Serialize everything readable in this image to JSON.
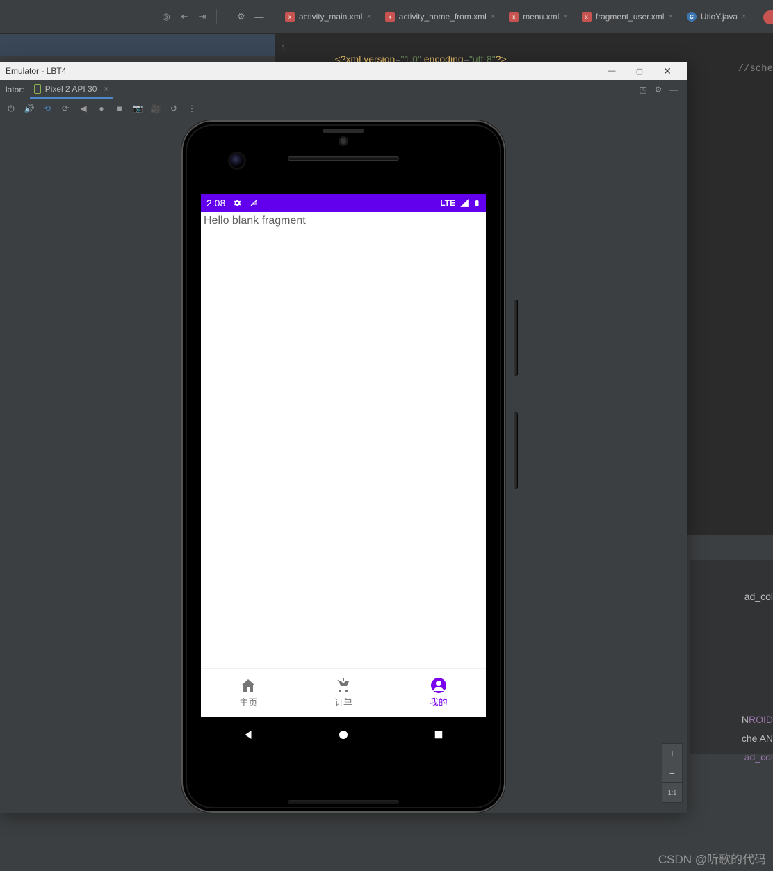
{
  "ide_toolbar": {
    "icons": [
      "target",
      "indent-left",
      "indent-right",
      "sep",
      "gear",
      "minus"
    ]
  },
  "file_tabs": [
    {
      "name": "activity_main.xml",
      "type": "xml"
    },
    {
      "name": "activity_home_from.xml",
      "type": "xml"
    },
    {
      "name": "menu.xml",
      "type": "xml"
    },
    {
      "name": "fragment_user.xml",
      "type": "xml"
    },
    {
      "name": "UtioY.java",
      "type": "java"
    }
  ],
  "editor": {
    "line_num": "1",
    "code_prefix": "<?",
    "code_xml": "xml version",
    "code_eq1": "=",
    "code_v1": "\"1.0\"",
    "code_enc": " encoding",
    "code_eq2": "=",
    "code_v2": "\"utf-8\"",
    "code_suffix": "?>",
    "right_frag": "//sche"
  },
  "emulator": {
    "title": "Emulator - LBT4",
    "subbar_label": "lator:",
    "device": "Pixel 2 API 30"
  },
  "phone": {
    "status_time": "2:08",
    "status_lte": "LTE",
    "fragment_text": "Hello blank fragment",
    "nav_items": [
      {
        "label": "主页"
      },
      {
        "label": "订单"
      },
      {
        "label": "我的"
      }
    ]
  },
  "zoom": {
    "btn1": "+",
    "btn2": "−",
    "btn3": "1:1"
  },
  "right_fragments": {
    "r1": "ad_col",
    "r2": "",
    "r3": "",
    "r4": "ROID",
    "r5": "che AN",
    "r6": "ad_col"
  },
  "watermark": "CSDN @听歌的代码"
}
